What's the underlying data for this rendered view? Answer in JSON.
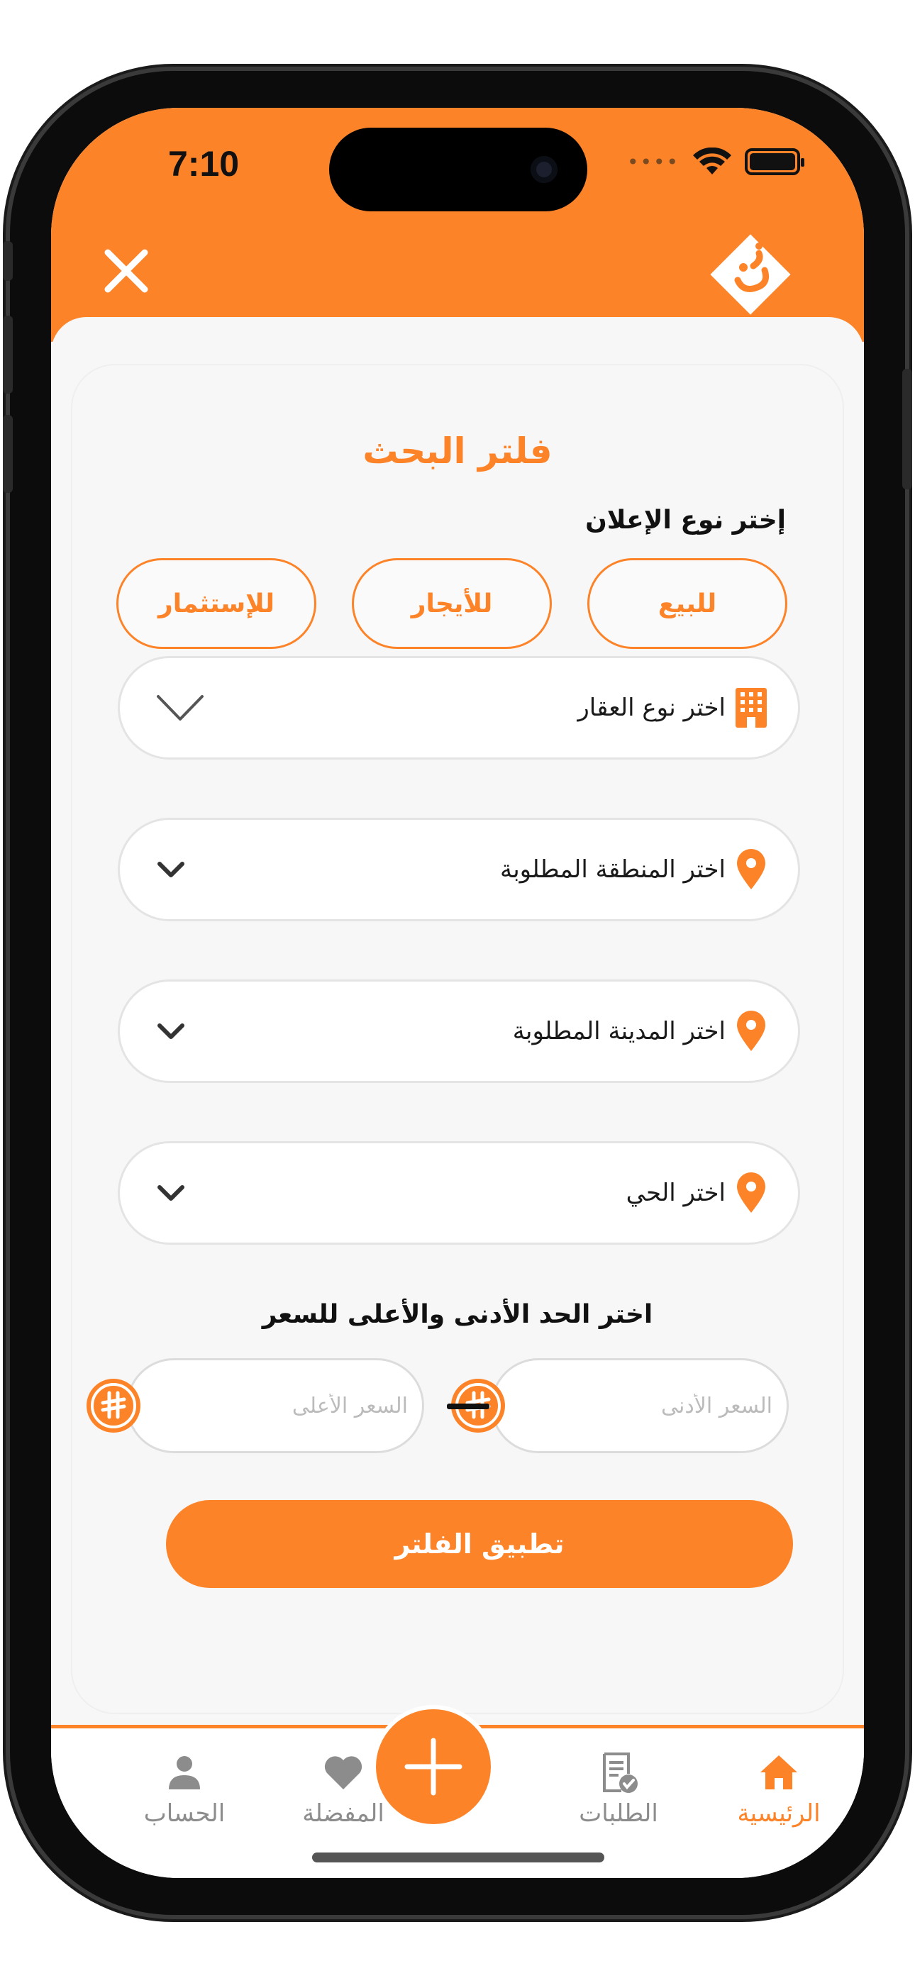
{
  "status_bar": {
    "time": "7:10",
    "signal_dots": "••••"
  },
  "header": {
    "close_label": "close",
    "logo_text": "وح"
  },
  "filter": {
    "title": "فلتر البحث",
    "ad_type_label": "إختر نوع الإعلان",
    "ad_types": [
      "للبيع",
      "للأيجار",
      "للإستثمار"
    ],
    "property_type_placeholder": "اختر نوع العقار",
    "region_placeholder": "اختر المنطقة المطلوبة",
    "city_placeholder": "اختر المدينة المطلوبة",
    "district_placeholder": "اختر الحي",
    "price_label": "اختر الحد الأدنى والأعلى للسعر",
    "min_price_placeholder": "السعر الأدنى",
    "max_price_placeholder": "السعر الأعلى",
    "apply_label": "تطبيق الفلتر"
  },
  "tabbar": {
    "home": "الرئيسية",
    "orders": "الطلبات",
    "favorites": "المفضلة",
    "account": "الحساب"
  },
  "colors": {
    "accent": "#fd8328",
    "inactive": "#8c8c8c",
    "background": "#f7f7f7"
  }
}
